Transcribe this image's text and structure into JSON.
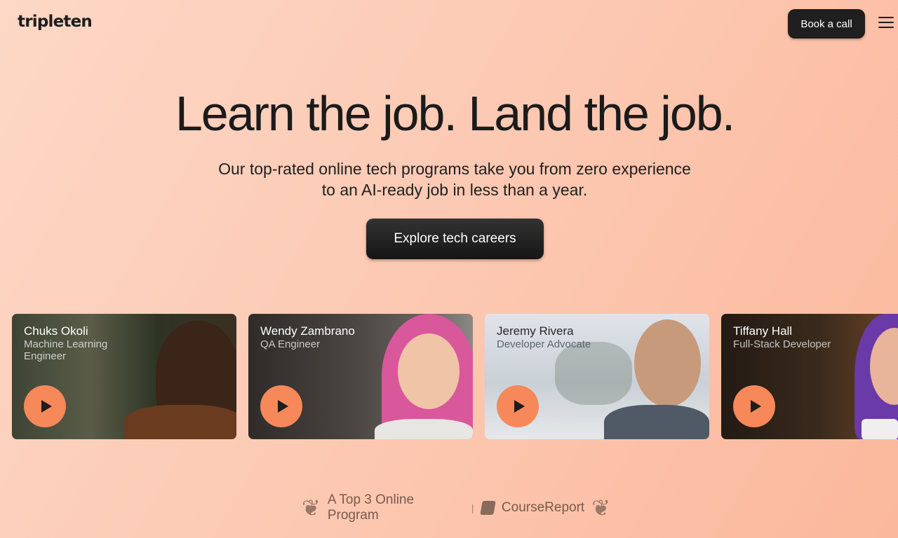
{
  "header": {
    "logo": "tripleten",
    "book_call": "Book a call",
    "menu_icon": "hamburger-menu-icon"
  },
  "hero": {
    "title": "Learn the job. Land the job.",
    "subtitle": "Our top-rated online tech programs take you from zero experience to an AI-ready job in less than a year.",
    "cta": "Explore tech careers"
  },
  "cards": [
    {
      "name": "Chuks Okoli",
      "role": "Machine Learning Engineer"
    },
    {
      "name": "Wendy Zambrano",
      "role": "QA Engineer"
    },
    {
      "name": "Jeremy Rivera",
      "role": "Developer Advocate"
    },
    {
      "name": "Tiffany Hall",
      "role": "Full-Stack Developer"
    }
  ],
  "awards": {
    "program": "A Top 3 Online Program",
    "separator": "|",
    "source": "CourseReport"
  },
  "colors": {
    "accent": "#f6885a",
    "dark_button": "#1f1f1f",
    "background": "#fccab4"
  }
}
